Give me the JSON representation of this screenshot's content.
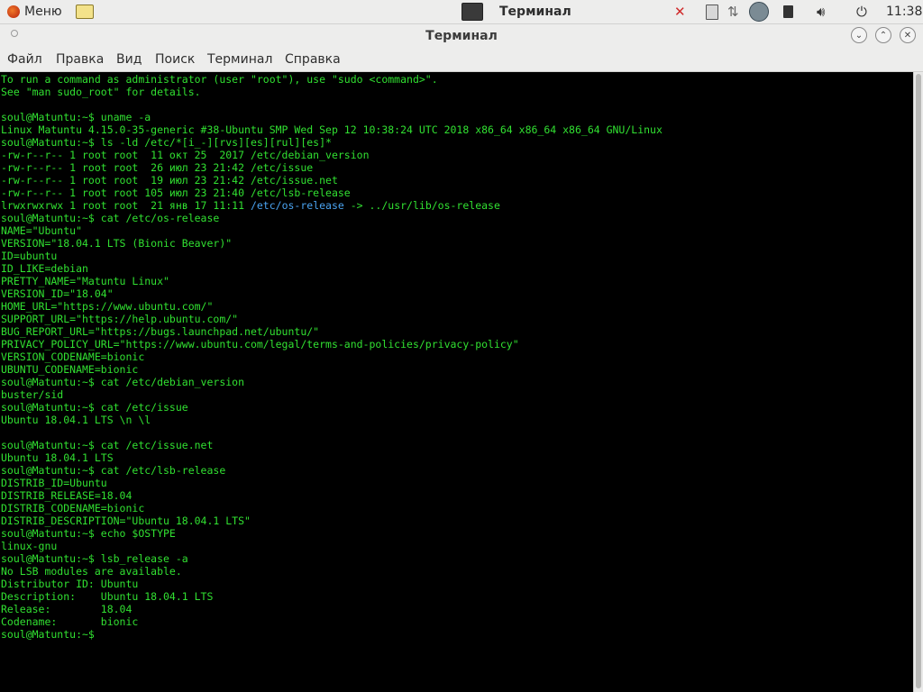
{
  "panel": {
    "menu_label": "Меню",
    "task_label": "Терминал",
    "clock": "11:38"
  },
  "window": {
    "title": "Терминал"
  },
  "menubar": {
    "items": [
      "Файл",
      "Правка",
      "Вид",
      "Поиск",
      "Терминал",
      "Справка"
    ]
  },
  "terminal": {
    "lines": [
      "To run a command as administrator (user \"root\"), use \"sudo <command>\".",
      "See \"man sudo_root\" for details.",
      "",
      "soul@Matuntu:~$ uname -a",
      "Linux Matuntu 4.15.0-35-generic #38-Ubuntu SMP Wed Sep 12 10:38:24 UTC 2018 x86_64 x86_64 x86_64 GNU/Linux",
      "soul@Matuntu:~$ ls -ld /etc/*[i_-][rvs][es][rul][es]*",
      "-rw-r--r-- 1 root root  11 окт 25  2017 /etc/debian_version",
      "-rw-r--r-- 1 root root  26 июл 23 21:42 /etc/issue",
      "-rw-r--r-- 1 root root  19 июл 23 21:42 /etc/issue.net",
      "-rw-r--r-- 1 root root 105 июл 23 21:40 /etc/lsb-release",
      "lrwxrwxrwx 1 root root  21 янв 17 11:11 ",
      "soul@Matuntu:~$ cat /etc/os-release",
      "NAME=\"Ubuntu\"",
      "VERSION=\"18.04.1 LTS (Bionic Beaver)\"",
      "ID=ubuntu",
      "ID_LIKE=debian",
      "PRETTY_NAME=\"Matuntu Linux\"",
      "VERSION_ID=\"18.04\"",
      "HOME_URL=\"https://www.ubuntu.com/\"",
      "SUPPORT_URL=\"https://help.ubuntu.com/\"",
      "BUG_REPORT_URL=\"https://bugs.launchpad.net/ubuntu/\"",
      "PRIVACY_POLICY_URL=\"https://www.ubuntu.com/legal/terms-and-policies/privacy-policy\"",
      "VERSION_CODENAME=bionic",
      "UBUNTU_CODENAME=bionic",
      "soul@Matuntu:~$ cat /etc/debian_version",
      "buster/sid",
      "soul@Matuntu:~$ cat /etc/issue",
      "Ubuntu 18.04.1 LTS \\n \\l",
      "",
      "soul@Matuntu:~$ cat /etc/issue.net",
      "Ubuntu 18.04.1 LTS",
      "soul@Matuntu:~$ cat /etc/lsb-release",
      "DISTRIB_ID=Ubuntu",
      "DISTRIB_RELEASE=18.04",
      "DISTRIB_CODENAME=bionic",
      "DISTRIB_DESCRIPTION=\"Ubuntu 18.04.1 LTS\"",
      "soul@Matuntu:~$ echo $OSTYPE",
      "linux-gnu",
      "soul@Matuntu:~$ lsb_release -a",
      "No LSB modules are available.",
      "Distributor ID:\tUbuntu",
      "Description:\tUbuntu 18.04.1 LTS",
      "Release:\t18.04",
      "Codename:\tbionic",
      "soul@Matuntu:~$ "
    ],
    "symlink_name": "/etc/os-release",
    "symlink_target": " -> ../usr/lib/os-release"
  },
  "colors": {
    "terminal_fg": "#31e031",
    "terminal_bg": "#000000",
    "symlink": "#4aa3f0"
  }
}
